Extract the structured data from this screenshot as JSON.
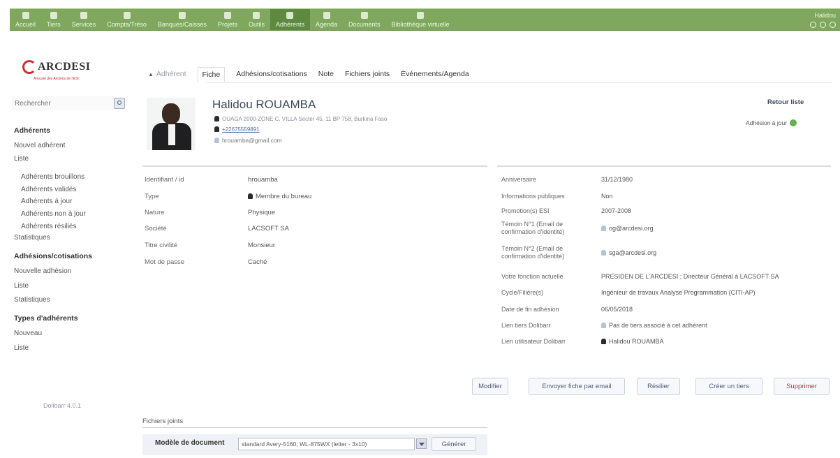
{
  "topbar": {
    "items": [
      {
        "label": "Accueil",
        "icon": "home-icon"
      },
      {
        "label": "Tiers",
        "icon": "building-icon"
      },
      {
        "label": "Services",
        "icon": "services-icon"
      },
      {
        "label": "Compta/Tréso",
        "icon": "money-icon"
      },
      {
        "label": "Banques/Caisses",
        "icon": "bank-icon"
      },
      {
        "label": "Projets",
        "icon": "project-icon"
      },
      {
        "label": "Outils",
        "icon": "tools-icon"
      },
      {
        "label": "Adhérents",
        "icon": "members-icon"
      },
      {
        "label": "Agenda",
        "icon": "calendar-icon"
      },
      {
        "label": "Documents",
        "icon": "documents-icon"
      },
      {
        "label": "Bibliothèque virtuelle",
        "icon": "library-icon"
      }
    ],
    "active_index": 7,
    "user": "Halidou",
    "color": "#7fa85e"
  },
  "logo": {
    "text": "ARCDESI",
    "sub": "Amicale des Anciens de l'ESI"
  },
  "search": {
    "placeholder": "Rechercher"
  },
  "sidebar": {
    "adherents_title": "Adhérents",
    "nouvel": "Nouvel adhérent",
    "liste": "Liste",
    "brouillons": "Adhérents brouillons",
    "valides": "Adhérents validés",
    "a_jour": "Adhérents à jour",
    "non_a_jour": "Adhérents non à jour",
    "resilies": "Adhérents résiliés",
    "statistiques": "Statistiques",
    "adhesions_title": "Adhésions/cotisations",
    "nouvelle_adhesion": "Nouvelle adhésion",
    "liste2": "Liste",
    "statistiques2": "Statistiques",
    "types_title": "Types d'adhérents",
    "nouveau": "Nouveau",
    "liste3": "Liste",
    "version": "Dolibarr 4.0.1"
  },
  "tabs": {
    "first": "Adhérent",
    "fiche": "Fiche",
    "adhesions": "Adhésions/cotisations",
    "note": "Note",
    "fichiers": "Fichiers joints",
    "evenements": "Événements/Agenda"
  },
  "profile": {
    "name": "Halidou ROUAMBA",
    "address": "OUAGA 2000-ZONE C. VILLA Secter 45, 11 BP 758, Burkina Faso",
    "phone": "+22675559891",
    "email": "hrouamba@gmail.com",
    "retour": "Retour liste",
    "status": "Adhésion à jour",
    "status_color": "#62b14a"
  },
  "left_details": [
    {
      "label": "Identifiant / id",
      "value": "hrouamba"
    },
    {
      "label": "Type",
      "value": "Membre du bureau"
    },
    {
      "label": "Nature",
      "value": "Physique"
    },
    {
      "label": "Société",
      "value": "LACSOFT SA"
    },
    {
      "label": "Titre civilité",
      "value": "Monsieur"
    },
    {
      "label": "Mot de passe",
      "value": "Caché"
    }
  ],
  "right_details": [
    {
      "label": "Anniversaire",
      "value": "31/12/1980"
    },
    {
      "label": "Informations publiques",
      "value": "Non"
    },
    {
      "label": "Promotion(s) ESI",
      "value": "2007-2008"
    },
    {
      "label": "Témoin N°1 (Email de confirmation d'identité)",
      "value": "og@arcdesi.org"
    },
    {
      "label": "Témoin N°2 (Email de confirmation d'identité)",
      "value": "sga@arcdesi.org"
    },
    {
      "label": "Votre fonction actuelle",
      "value": "PRESIDEN DE L'ARCDESI ; Directeur Général à LACSOFT SA"
    },
    {
      "label": "Cycle/Filière(s)",
      "value": "Ingénieur de travaux Analyse Programmation (CITI-AP)"
    },
    {
      "label": "Date de fin adhésion",
      "value": "06/05/2018"
    },
    {
      "label": "Lien tiers Dolibarr",
      "value": "Pas de tiers associé à cet adhérent"
    },
    {
      "label": "Lien utilisateur Dolibarr",
      "value": "Halidou ROUAMBA"
    }
  ],
  "actions": {
    "modifier": "Modifier",
    "envoyer": "Envoyer fiche par email",
    "resilier": "Résilier",
    "creer_tiers": "Créer un tiers",
    "supprimer": "Supprimer"
  },
  "bottom": {
    "files_title": "Fichiers joints",
    "model_label": "Modèle de document",
    "model_value": "standard Avery-5160, WL-875WX (letter - 3x10)",
    "generate": "Générer"
  }
}
